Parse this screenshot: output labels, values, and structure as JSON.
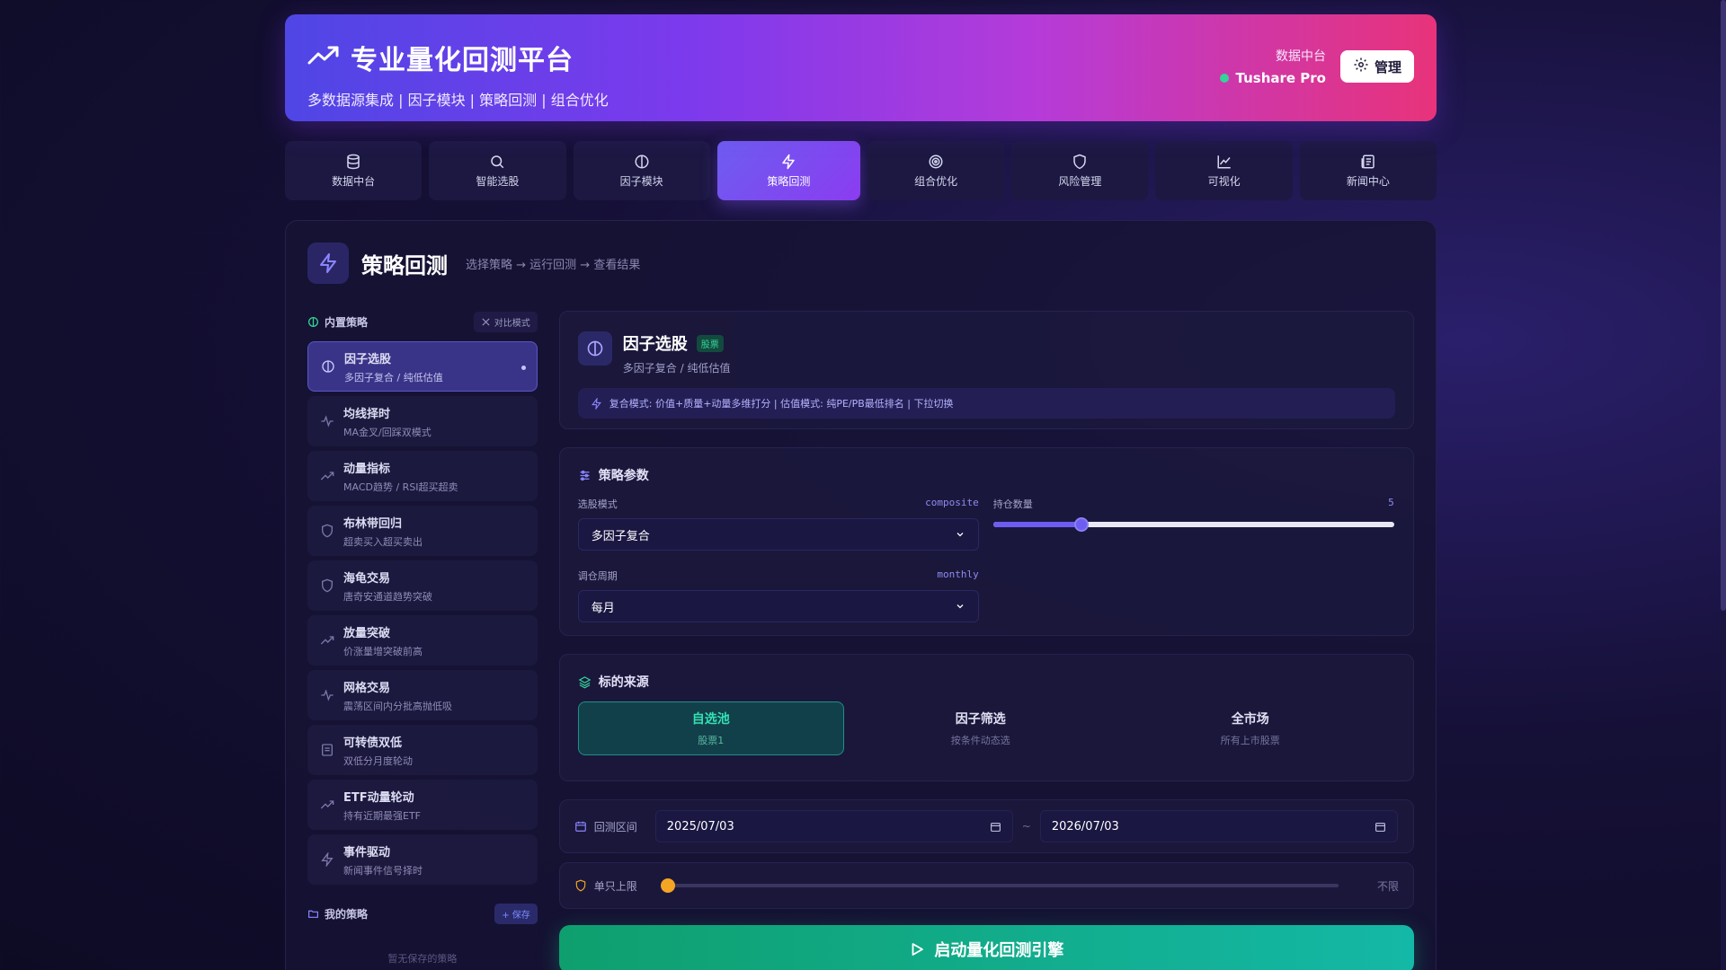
{
  "header": {
    "title": "专业量化回测平台",
    "subtitle": "多数据源集成 | 因子模块 | 策略回测 | 组合优化",
    "source_label": "数据中台",
    "source_name": "Tushare Pro",
    "manage_label": "管理"
  },
  "nav": [
    {
      "label": "数据中台",
      "icon": "database-icon"
    },
    {
      "label": "智能选股",
      "icon": "search-icon"
    },
    {
      "label": "因子模块",
      "icon": "half-circle-icon"
    },
    {
      "label": "策略回测",
      "icon": "lightning-icon",
      "active": true
    },
    {
      "label": "组合优化",
      "icon": "target-icon"
    },
    {
      "label": "风险管理",
      "icon": "shield-icon"
    },
    {
      "label": "可视化",
      "icon": "line-chart-icon"
    },
    {
      "label": "新闻中心",
      "icon": "newspaper-icon"
    }
  ],
  "panel": {
    "title": "策略回测",
    "hint": "选择策略 → 运行回测 → 查看结果"
  },
  "builtin": {
    "label": "内置策略",
    "compare_label": "对比模式",
    "items": [
      {
        "name": "因子选股",
        "desc": "多因子复合 / 纯低估值",
        "active": true
      },
      {
        "name": "均线择时",
        "desc": "MA金叉/回踩双模式"
      },
      {
        "name": "动量指标",
        "desc": "MACD趋势 / RSI超买超卖"
      },
      {
        "name": "布林带回归",
        "desc": "超卖买入超买卖出"
      },
      {
        "name": "海龟交易",
        "desc": "唐奇安通道趋势突破"
      },
      {
        "name": "放量突破",
        "desc": "价涨量增突破前高"
      },
      {
        "name": "网格交易",
        "desc": "震荡区间内分批高抛低吸"
      },
      {
        "name": "可转债双低",
        "desc": "双低分月度轮动"
      },
      {
        "name": "ETF动量轮动",
        "desc": "持有近期最强ETF"
      },
      {
        "name": "事件驱动",
        "desc": "新闻事件信号择时"
      }
    ]
  },
  "mine": {
    "label": "我的策略",
    "save_label": "+ 保存",
    "empty": "暂无保存的策略"
  },
  "factor": {
    "name": "因子选股",
    "tag": "股票",
    "desc": "多因子复合 / 纯低估值",
    "note": "复合模式: 价值+质量+动量多维打分 | 估值模式: 纯PE/PB最低排名 | 下拉切换"
  },
  "params": {
    "title": "策略参数",
    "mode_label": "选股模式",
    "mode_code": "composite",
    "mode_value": "多因子复合",
    "holdings_label": "持仓数量",
    "holdings_value": "5",
    "holdings_fraction": 0.22,
    "rebalance_label": "调仓周期",
    "rebalance_code": "monthly",
    "rebalance_value": "每月"
  },
  "source": {
    "title": "标的来源",
    "options": [
      {
        "name": "自选池",
        "desc": "股票1",
        "active": true
      },
      {
        "name": "因子筛选",
        "desc": "按条件动态选"
      },
      {
        "name": "全市场",
        "desc": "所有上市股票"
      }
    ]
  },
  "backtest": {
    "range_label": "回测区间",
    "start": "2025/07/03",
    "separator": "~",
    "end": "2026/07/03"
  },
  "limit": {
    "label": "单只上限",
    "value": "不限"
  },
  "run_label": "启动量化回测引擎"
}
